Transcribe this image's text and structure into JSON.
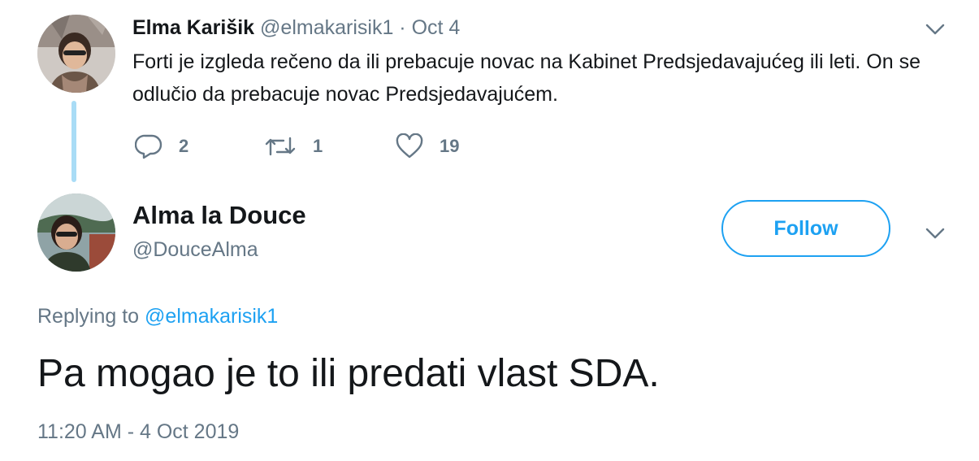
{
  "parent_tweet": {
    "author_name": "Elma Karišik",
    "author_handle": "@elmakarisik1",
    "date_separator": " · ",
    "date": "Oct 4",
    "text": "Forti je izgleda rečeno da ili  prebacuje novac na Kabinet Predsjedavajućeg ili leti. On se odlučio da prebacuje novac Predsjedavajućem.",
    "stats": {
      "replies": "2",
      "retweets": "1",
      "likes": "19"
    },
    "icons": {
      "reply": "reply-icon",
      "retweet": "retweet-icon",
      "like": "heart-icon",
      "menu": "chevron-down-icon"
    }
  },
  "main_tweet": {
    "author_name": "Alma la Douce",
    "author_handle": "@DouceAlma",
    "follow_label": "Follow",
    "replying_prefix": "Replying to ",
    "replying_to": "@elmakarisik1",
    "text": "Pa mogao je to ili predati vlast SDA.",
    "timestamp": "11:20 AM - 4 Oct 2019",
    "icons": {
      "menu": "chevron-down-icon"
    }
  },
  "colors": {
    "accent": "#1da1f2",
    "thread_line": "#a9dcf6",
    "secondary_text": "#657786",
    "primary_text": "#14171a"
  }
}
